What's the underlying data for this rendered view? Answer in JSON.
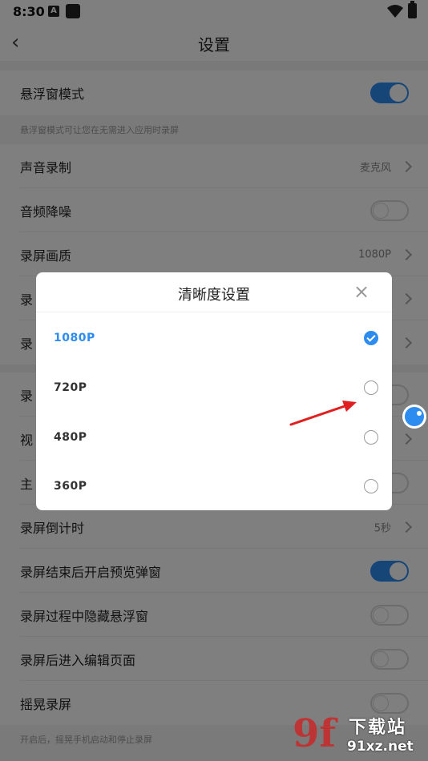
{
  "status_bar": {
    "time": "8:30",
    "a_icon_letter": "A"
  },
  "header": {
    "title": "设置"
  },
  "settings": {
    "floating_mode": {
      "label": "悬浮窗模式",
      "toggle": true
    },
    "floating_note": "悬浮窗模式可让您在无需进入应用时录屏",
    "audio_record": {
      "label": "声音录制",
      "value": "麦克风"
    },
    "noise_reduction": {
      "label": "音频降噪",
      "toggle": false
    },
    "quality": {
      "label": "录屏画质",
      "value": "1080P"
    },
    "row4_label": "录",
    "row5_label": "录",
    "row6_label": "录",
    "row7_label": "视",
    "row8_label": "主",
    "countdown": {
      "label": "录屏倒计时",
      "value": "5秒"
    },
    "preview_popup": {
      "label": "录屏结束后开启预览弹窗",
      "toggle": true
    },
    "hide_float": {
      "label": "录屏过程中隐藏悬浮窗",
      "toggle": false
    },
    "enter_edit": {
      "label": "录屏后进入编辑页面",
      "toggle": false
    },
    "shake_record": {
      "label": "摇晃录屏",
      "toggle": false
    },
    "shake_note": "开启后，摇晃手机启动和停止录屏"
  },
  "dialog": {
    "title": "清晰度设置",
    "options": [
      {
        "label": "1080P",
        "selected": true
      },
      {
        "label": "720P",
        "selected": false
      },
      {
        "label": "480P",
        "selected": false
      },
      {
        "label": "360P",
        "selected": false
      }
    ]
  },
  "watermark": {
    "top": "下载站",
    "bottom": "91xz.net"
  },
  "colors": {
    "accent": "#2d8cf0",
    "annotation_arrow": "#e02020"
  }
}
